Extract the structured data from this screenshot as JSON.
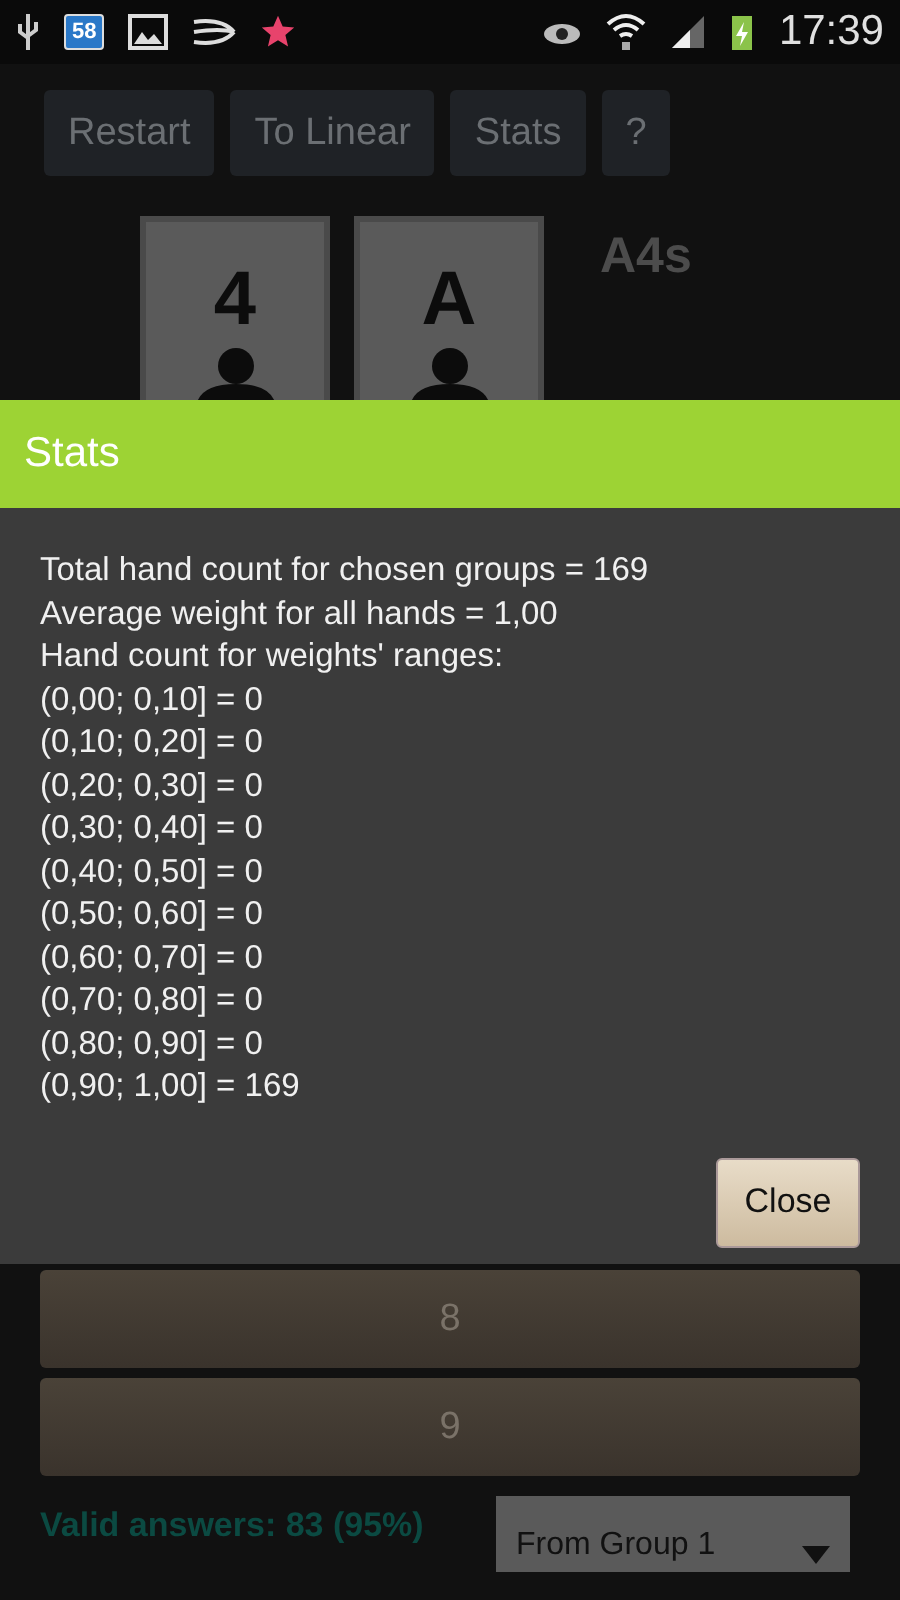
{
  "status_bar": {
    "notification_count": "58",
    "time": "17:39"
  },
  "toolbar": [
    "Restart",
    "To Linear",
    "Stats",
    "?"
  ],
  "cards": [
    "4",
    "A"
  ],
  "hand": "A4s",
  "dialog": {
    "title": "Stats",
    "lines": [
      "Total hand count for chosen groups = 169",
      "Average weight for all hands = 1,00",
      "Hand count for weights' ranges:",
      "(0,00; 0,10] = 0",
      "(0,10; 0,20] = 0",
      "(0,20; 0,30] = 0",
      "(0,30; 0,40] = 0",
      "(0,40; 0,50] = 0",
      "(0,50; 0,60] = 0",
      "(0,60; 0,70] = 0",
      "(0,70; 0,80] = 0",
      "(0,80; 0,90] = 0",
      "(0,90; 1,00] = 169"
    ],
    "button": "Close"
  },
  "answers": [
    "8",
    "9"
  ],
  "valid_answers": "Valid answers: 83 (95%)",
  "group_select": {
    "value": "From Group 1"
  }
}
